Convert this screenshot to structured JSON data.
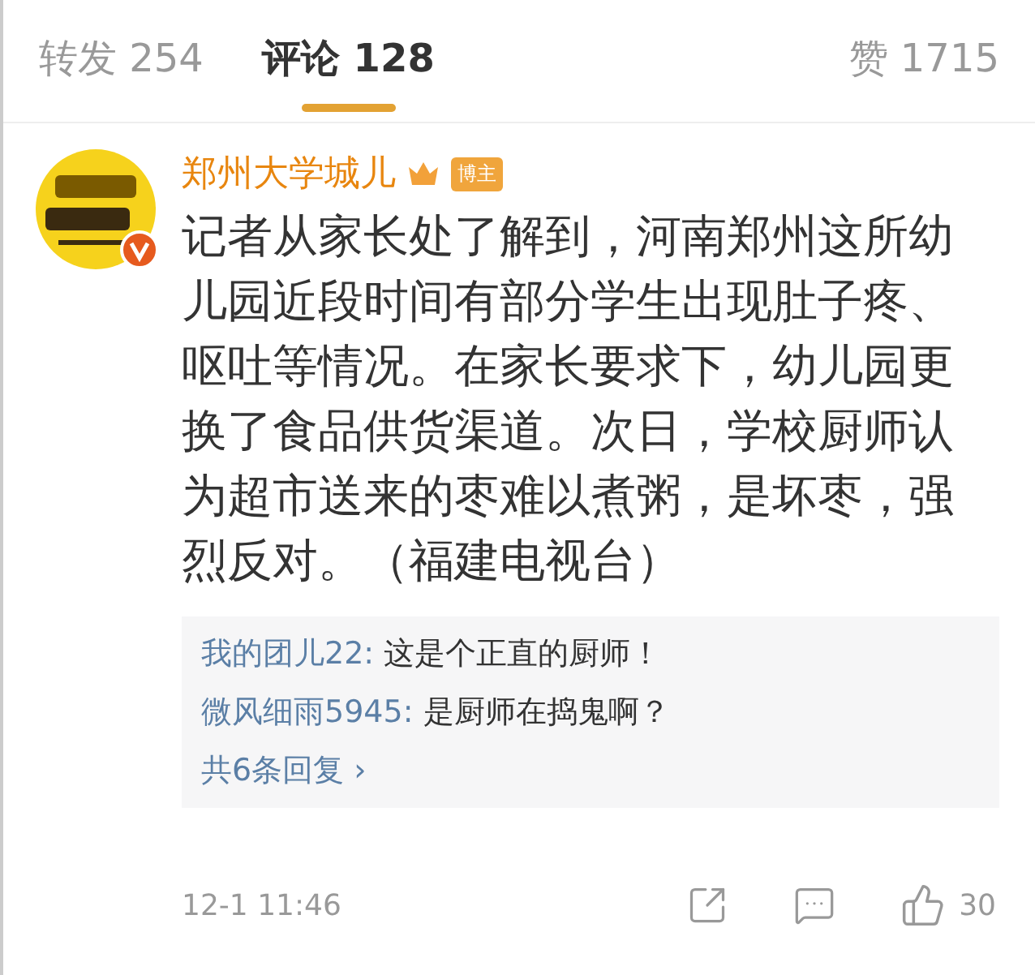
{
  "tabs": [
    {
      "label": "转发 254",
      "selected": false
    },
    {
      "label": "评论 128",
      "selected": true
    },
    {
      "label": "赞 1715",
      "selected": false
    }
  ],
  "comment": {
    "author": "郑州大学城儿",
    "badge": "博主",
    "verified": true,
    "text": "记者从家长处了解到，河南郑州这所幼儿园近段时间有部分学生出现肚子疼、呕吐等情况。在家长要求下，幼儿园更换了食品供货渠道。次日，学校厨师认为超市送来的枣难以煮粥，是坏枣，强烈反对。（福建电视台）",
    "replies": [
      {
        "user": "我的团儿22:",
        "text": "这是个正直的厨师！"
      },
      {
        "user": "微风细雨5945:",
        "text": "是厨师在捣鬼啊？"
      }
    ],
    "more_replies": "共6条回复 ›",
    "time": "12-1 11:46",
    "likes": "30"
  }
}
